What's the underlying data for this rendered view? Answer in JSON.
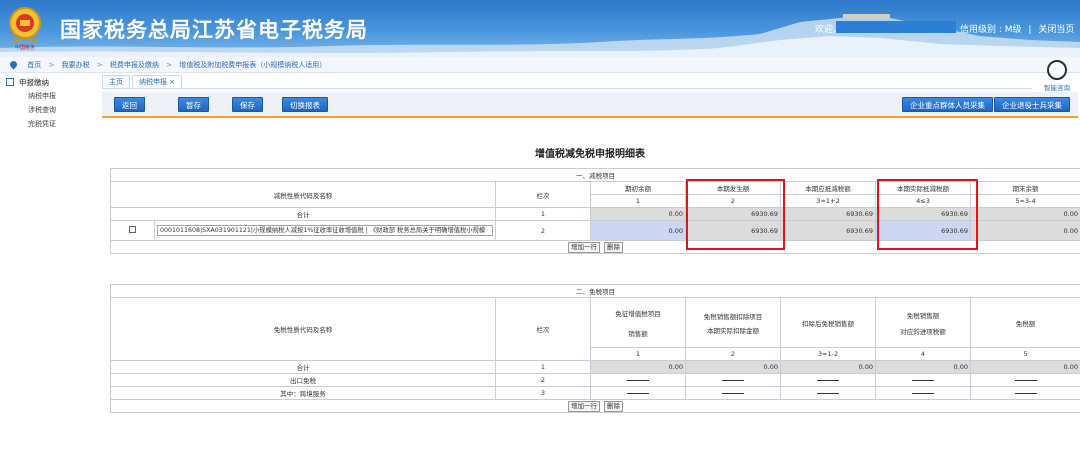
{
  "header": {
    "title": "国家税务总局江苏省电子税务局",
    "welcome": "欢迎,",
    "credit_level": "信用级别 : M级",
    "close_label": "关闭当页",
    "divider": "|"
  },
  "breadcrumb": [
    "首页",
    "我要办税",
    "税费申报及缴纳",
    "增值税及附加税费申报表（小规模纳税人适用）"
  ],
  "sidebar": {
    "heading": "申报缴纳",
    "items": [
      "纳税申报",
      "涉税查询",
      "完税凭证"
    ]
  },
  "tabs": [
    {
      "label": "主页"
    },
    {
      "label": "纳税申报 ×"
    }
  ],
  "consult_label": "智能咨询",
  "toolbar": {
    "buttons": [
      "返回",
      "暂存",
      "保存",
      "切换报表"
    ],
    "right_buttons": [
      "企业重点群体人员采集",
      "企业退役士兵采集"
    ]
  },
  "form_title": "增值税减免税申报明细表",
  "reduction": {
    "section_title": "一、减税项目",
    "name_header": "减税性质代码及名称",
    "line_header": "栏次",
    "col_headers": [
      "期初余额",
      "本期发生额",
      "本期应抵减税额",
      "本期实际抵减税额",
      "期末余额"
    ],
    "col_codes": [
      "1",
      "2",
      "3=1+2",
      "4≤3",
      "5=3-4"
    ],
    "total_row": {
      "name": "合计",
      "line": "1",
      "values": [
        "0.00",
        "6930.69",
        "6930.69",
        "6930.69",
        "0.00"
      ]
    },
    "item_row": {
      "name": "0001011608|SXA031901121|小规模纳税人减按1%征收率征收增值税 | 《财政部 税务总局关于明确增值税小规模",
      "line": "2",
      "values": [
        "0.00",
        "6930.69",
        "6930.69",
        "6930.69",
        "0.00"
      ]
    },
    "add_label": "增加一行",
    "delete_label": "删除"
  },
  "exemption": {
    "section_title": "二、免税项目",
    "name_header": "免税性质代码及名称",
    "line_header": "栏次",
    "col_headers": [
      [
        "免征增值税项目",
        "销售额"
      ],
      [
        "免税销售额扣除项目",
        "本期实际扣除金额"
      ],
      [
        "扣除后免税销售额",
        ""
      ],
      [
        "免税销售额",
        "对应的进项税额"
      ],
      [
        "免税额",
        ""
      ]
    ],
    "col_codes": [
      "1",
      "2",
      "3=1-2",
      "4",
      "5"
    ],
    "total_row": {
      "name": "合计",
      "line": "1",
      "values": [
        "0.00",
        "0.00",
        "0.00",
        "0.00",
        "0.00"
      ]
    },
    "export_row": {
      "name": "出口免税",
      "line": "2"
    },
    "cross_row": {
      "name": "其中：跨境服务",
      "line": "3"
    },
    "add_label": "增加一行",
    "delete_label": "删除"
  }
}
